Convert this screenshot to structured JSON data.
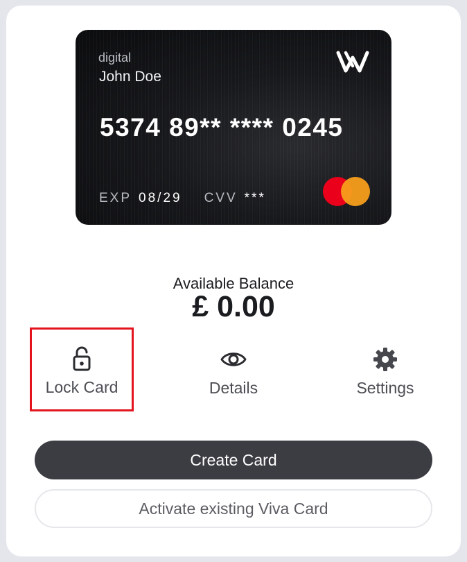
{
  "card": {
    "type_label": "digital",
    "holder_name": "John Doe",
    "number": "5374 89** **** 0245",
    "exp_label": "EXP",
    "exp_value": "08/29",
    "cvv_label": "CVV",
    "cvv_value": "***",
    "brand_logo_icon": "viva-w-logo",
    "network_icon": "mastercard-logo",
    "colors": {
      "card_background": "#141518",
      "mastercard_red": "#eb001b",
      "mastercard_orange": "#f79e1b"
    }
  },
  "balance": {
    "label": "Available Balance",
    "value": "£ 0.00"
  },
  "actions": [
    {
      "label": "Lock Card",
      "icon": "unlocked-padlock-icon",
      "highlighted": true
    },
    {
      "label": "Details",
      "icon": "eye-icon"
    },
    {
      "label": "Settings",
      "icon": "gear-icon"
    }
  ],
  "buttons": {
    "create_label": "Create Card",
    "activate_label": "Activate existing Viva Card"
  },
  "colors": {
    "page_background": "#e4e6ec",
    "panel_background": "#ffffff",
    "primary_button": "#3c3d43",
    "highlight_border": "#e3141e"
  }
}
